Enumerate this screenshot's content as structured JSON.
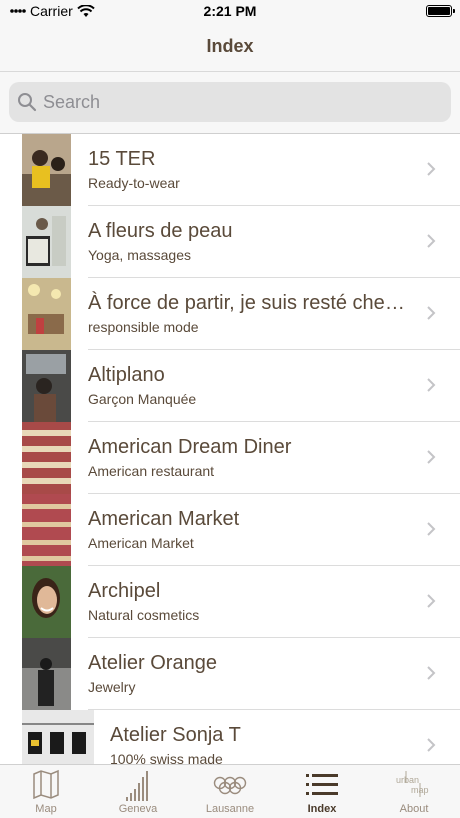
{
  "status": {
    "carrier": "Carrier",
    "time": "2:21 PM"
  },
  "nav": {
    "title": "Index"
  },
  "search": {
    "placeholder": "Search"
  },
  "list": [
    {
      "title": "15 TER",
      "subtitle": "Ready-to-wear"
    },
    {
      "title": "A fleurs de peau",
      "subtitle": "Yoga, massages"
    },
    {
      "title": "À force de partir, je suis resté chez moi",
      "subtitle": "responsible mode"
    },
    {
      "title": "Altiplano",
      "subtitle": "Garçon Manquée"
    },
    {
      "title": "American Dream Diner",
      "subtitle": "American restaurant"
    },
    {
      "title": "American Market",
      "subtitle": "American Market"
    },
    {
      "title": "Archipel",
      "subtitle": "Natural cosmetics"
    },
    {
      "title": "Atelier Orange",
      "subtitle": "Jewelry"
    },
    {
      "title": "Atelier Sonja T",
      "subtitle": "100% swiss made"
    }
  ],
  "tabs": [
    {
      "label": "Map",
      "icon": "map-icon"
    },
    {
      "label": "Geneva",
      "icon": "bars-icon"
    },
    {
      "label": "Lausanne",
      "icon": "rings-icon"
    },
    {
      "label": "Index",
      "icon": "list-icon"
    },
    {
      "label": "About",
      "icon": "urbanmap-logo-icon",
      "logo_text": "urban map"
    }
  ],
  "colors": {
    "accent": "#5a4a3a",
    "tab_active": "#4a3a2a",
    "tab_inactive": "#9a8c7e"
  }
}
